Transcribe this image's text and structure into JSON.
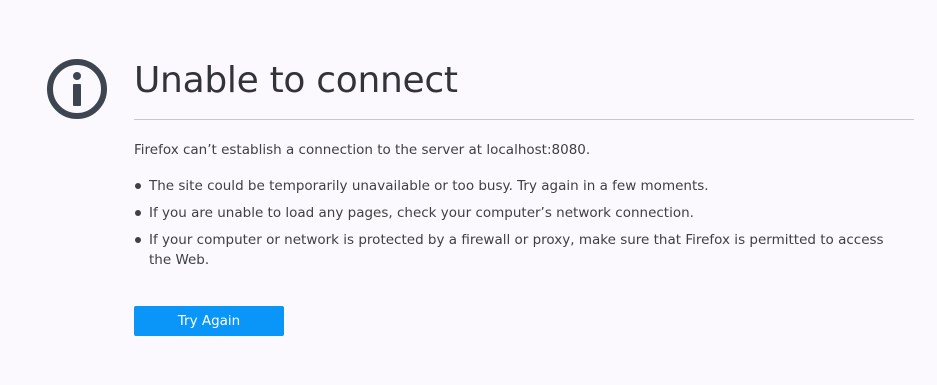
{
  "error": {
    "icon": "info-icon",
    "title": "Unable to connect",
    "description": "Firefox can’t establish a connection to the server at localhost:8080.",
    "reasons": [
      "The site could be temporarily unavailable or too busy. Try again in a few moments.",
      "If you are unable to load any pages, check your computer’s network connection.",
      "If your computer or network is protected by a firewall or proxy, make sure that Firefox is permitted to access the Web."
    ],
    "try_again_label": "Try Again"
  },
  "colors": {
    "background": "#fbf9fd",
    "icon": "#3d4550",
    "button": "#0996f8",
    "button_text": "#ffffff"
  }
}
